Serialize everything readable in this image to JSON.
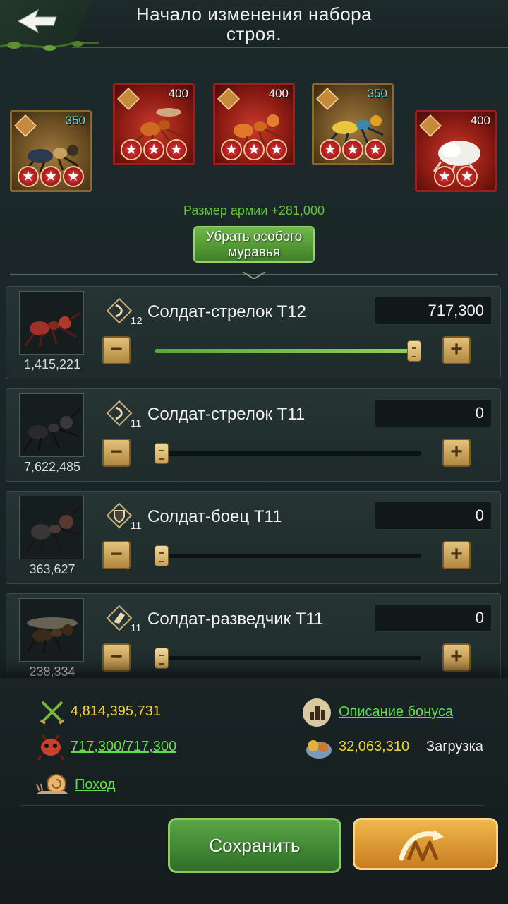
{
  "header": {
    "title": "Начало изменения набора строя."
  },
  "special_ants": [
    {
      "level": "350",
      "level_color": "cyan",
      "stars": 3,
      "frame": "gold"
    },
    {
      "level": "400",
      "level_color": "white",
      "stars": 3,
      "frame": "red"
    },
    {
      "level": "400",
      "level_color": "white",
      "stars": 3,
      "frame": "red"
    },
    {
      "level": "350",
      "level_color": "cyan",
      "stars": 3,
      "frame": "gold"
    },
    {
      "level": "400",
      "level_color": "white",
      "stars": 2,
      "frame": "red"
    }
  ],
  "army_size": "Размер армии +281,000",
  "remove_button": "Убрать особого муравья",
  "units": [
    {
      "name": "Солдат-стрелок T12",
      "tier": "12",
      "count": "1,415,221",
      "value": "717,300",
      "fill": 1.0,
      "icon": "bow-badge-icon"
    },
    {
      "name": "Солдат-стрелок T11",
      "tier": "11",
      "count": "7,622,485",
      "value": "0",
      "fill": 0.0,
      "icon": "bow-badge-icon"
    },
    {
      "name": "Солдат-боец T11",
      "tier": "11",
      "count": "363,627",
      "value": "0",
      "fill": 0.0,
      "icon": "shield-badge-icon"
    },
    {
      "name": "Солдат-разведчик T11",
      "tier": "11",
      "count": "238,334",
      "value": "0",
      "fill": 0.0,
      "icon": "wing-badge-icon"
    }
  ],
  "bottom": {
    "power": "4,814,395,731",
    "bonus_link": "Описание бонуса",
    "troops": "717,300/717,300",
    "load_value": "32,063,310",
    "load_label": "Загрузка",
    "march": "Поход",
    "save_button": "Сохранить"
  }
}
